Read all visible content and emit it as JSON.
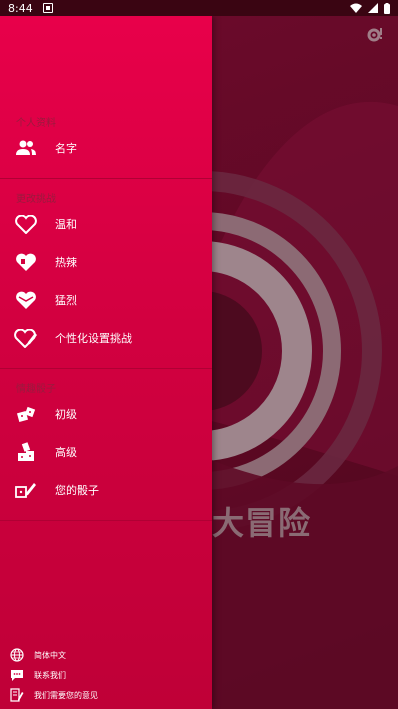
{
  "status_bar": {
    "time": "8:44"
  },
  "drawer": {
    "profile_section": {
      "header": "个人资料",
      "items": [
        {
          "label": "名字",
          "icon": "people-icon"
        }
      ]
    },
    "challenge_section": {
      "header": "更改挑战",
      "items": [
        {
          "label": "温和",
          "icon": "heart-outline-icon"
        },
        {
          "label": "热辣",
          "icon": "heart-lock-icon"
        },
        {
          "label": "猛烈",
          "icon": "heart-ribbon-icon"
        },
        {
          "label": "个性化设置挑战",
          "icon": "heart-edit-icon"
        }
      ]
    },
    "dice_section": {
      "header": "情趣骰子",
      "items": [
        {
          "label": "初级",
          "icon": "dice-icon"
        },
        {
          "label": "高级",
          "icon": "dice-stack-icon"
        },
        {
          "label": "您的骰子",
          "icon": "dice-edit-icon"
        }
      ]
    },
    "footer": [
      {
        "label": "简体中文",
        "icon": "globe-icon"
      },
      {
        "label": "联系我们",
        "icon": "chat-icon"
      },
      {
        "label": "我们需要您的意见",
        "icon": "feedback-icon"
      }
    ]
  },
  "background_app": {
    "title_visible": "大冒险",
    "settings_icon": "settings-icon"
  }
}
